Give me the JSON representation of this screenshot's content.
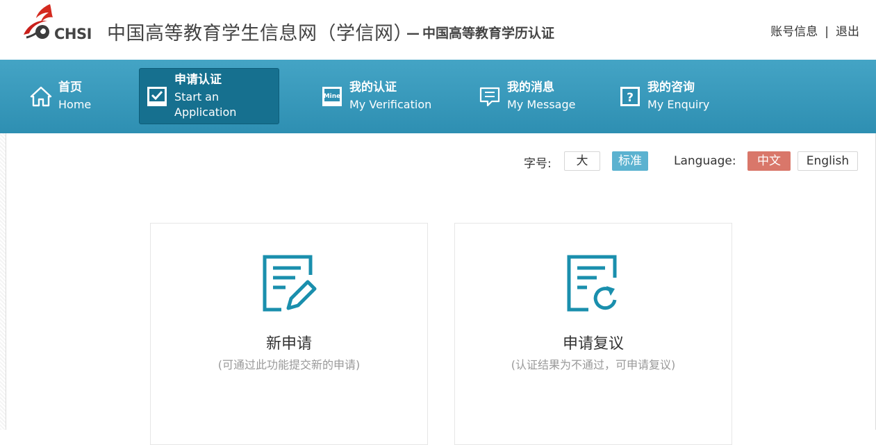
{
  "header": {
    "logo_text": "CHSI",
    "title": "中国高等教育学生信息网（学信网）",
    "subtitle_dash": "—",
    "subtitle": "中国高等教育学历认证",
    "account_link": "账号信息",
    "separator": "|",
    "logout_link": "退出"
  },
  "nav": {
    "items": [
      {
        "zh": "首页",
        "en": "Home",
        "icon": "home-icon",
        "active": false
      },
      {
        "zh": "申请认证",
        "en": "Start an Application",
        "icon": "checkbox-icon",
        "active": true
      },
      {
        "zh": "我的认证",
        "en": "My Verification",
        "icon": "mine-icon",
        "active": false
      },
      {
        "zh": "我的消息",
        "en": "My Message",
        "icon": "message-icon",
        "active": false
      },
      {
        "zh": "我的咨询",
        "en": "My Enquiry",
        "icon": "question-icon",
        "active": false
      }
    ]
  },
  "toolbar": {
    "font_size_label": "字号:",
    "font_large": "大",
    "font_standard": "标准",
    "language_label": "Language:",
    "lang_zh": "中文",
    "lang_en": "English"
  },
  "cards": [
    {
      "title": "新申请",
      "desc": "(可通过此功能提交新的申请)",
      "icon": "edit-form-icon"
    },
    {
      "title": "申请复议",
      "desc": "(认证结果为不通过，可申请复议)",
      "icon": "refresh-form-icon"
    }
  ],
  "colors": {
    "nav_bg": "#3a9bbe",
    "nav_active": "#16708f",
    "accent_blue": "#5bb2d0",
    "accent_red": "#d9776a",
    "icon_teal": "#1a8fad"
  }
}
